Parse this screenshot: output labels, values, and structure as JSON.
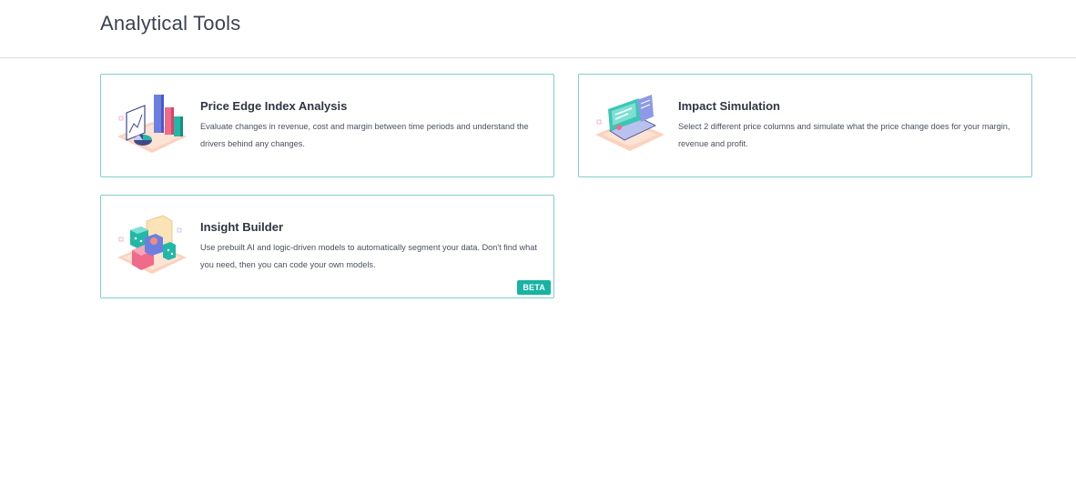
{
  "header": {
    "title": "Analytical Tools"
  },
  "cards": [
    {
      "title": "Price Edge Index Analysis",
      "description": "Evaluate changes in revenue, cost and margin between time periods and understand the drivers behind any changes.",
      "icon": "bar-chart-illustration-icon"
    },
    {
      "title": "Impact Simulation",
      "description": "Select 2 different price columns and simulate what the price change does for your margin, revenue and profit.",
      "icon": "simulation-illustration-icon"
    },
    {
      "title": "Insight Builder",
      "description": "Use prebuilt AI and logic-driven models to automatically segment your data. Don't find what you need, then you can code your own models.",
      "icon": "blocks-illustration-icon",
      "badge": "BETA"
    }
  ],
  "colors": {
    "card_border": "#7fcfd0",
    "badge": "#17b3a3",
    "title": "#3b4252"
  }
}
